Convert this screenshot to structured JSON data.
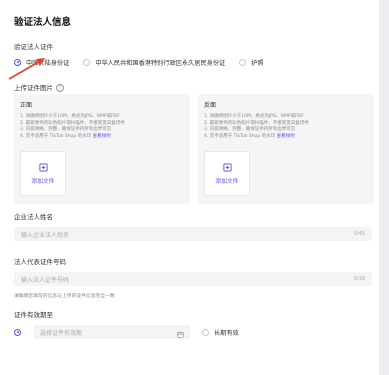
{
  "page": {
    "title": "验证法人信息"
  },
  "id_type": {
    "label": "验证法人证件",
    "options": [
      {
        "label": "中国大陆身份证",
        "selected": true
      },
      {
        "label": "中华人民共和国香港特别行政区永久居民身份证",
        "selected": false
      },
      {
        "label": "护照",
        "selected": false
      }
    ]
  },
  "upload": {
    "label": "上传证件图片",
    "help_icon": "?",
    "front": {
      "title": "正面",
      "rules": [
        "1. 请确保图片小于10M，格式为JPG、BMP或PDF",
        "2. 最新原件的彩色照片或扫描件，不接受黑白复印件",
        "3. 内容清晰、完整，确保证件的所有边界可见",
        "4. 无不适用于 TikTok Shop 的水印"
      ],
      "rules_link": "查看样例",
      "add_file": "添加文件"
    },
    "back": {
      "title": "反面",
      "rules": [
        "1. 请确保图片小于10M，格式为JPG、BMP或PDF",
        "2. 最新原件的彩色照片或扫描件，不接受黑白复印件",
        "3. 内容清晰、完整，确保证件的所有边界可见",
        "4. 无不适用于 TikTok Shop 的水印"
      ],
      "rules_link": "查看样例",
      "add_file": "添加文件"
    }
  },
  "legal_name": {
    "label": "企业法人姓名",
    "placeholder": "输入企业法人姓名",
    "counter": "0/45"
  },
  "id_number": {
    "label": "法人代表证件号码",
    "placeholder": "输入法人证件号码",
    "counter": "0/18",
    "hint": "请确保您填写的信息与上传的证件信息完全一致"
  },
  "validity": {
    "label": "证件有效期至",
    "date_placeholder": "选择证件有效期",
    "long_term": "长期有效"
  },
  "colors": {
    "accent": "#5a4fe0",
    "arrow": "#e8402e"
  }
}
